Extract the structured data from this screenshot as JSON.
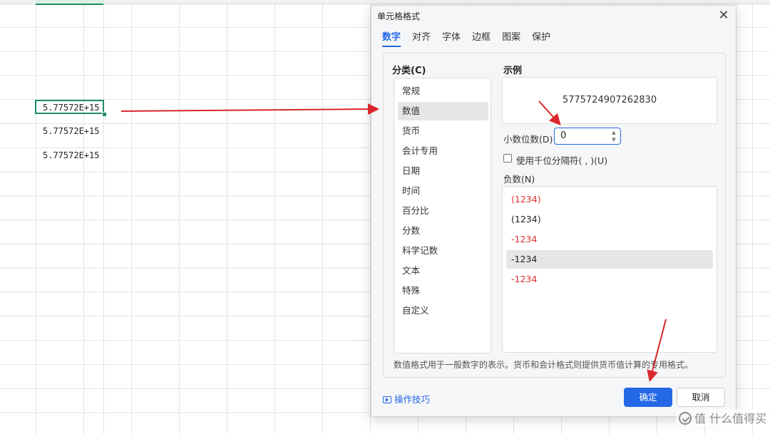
{
  "sheet": {
    "cells": [
      "5.77572E+15",
      "5.77572E+15",
      "5.77572E+15"
    ]
  },
  "dialog": {
    "title": "单元格格式",
    "close_icon": "close-icon",
    "tabs": [
      {
        "label": "数字",
        "active": true
      },
      {
        "label": "对齐"
      },
      {
        "label": "字体"
      },
      {
        "label": "边框"
      },
      {
        "label": "图案"
      },
      {
        "label": "保护"
      }
    ],
    "category_label": "分类(C)",
    "categories": [
      "常规",
      "数值",
      "货币",
      "会计专用",
      "日期",
      "时间",
      "百分比",
      "分数",
      "科学记数",
      "文本",
      "特殊",
      "自定义"
    ],
    "selected_category": "数值",
    "sample_label": "示例",
    "sample_value": "5775724907262830",
    "decimal_label": "小数位数(D)",
    "decimal_value": "0",
    "thousands_label": "使用千位分隔符( , )(U)",
    "thousands_checked": false,
    "negative_label": "负数(N)",
    "negative_options": [
      {
        "text": "(1234)",
        "color": "#e0312b"
      },
      {
        "text": "(1234)",
        "color": "#222222"
      },
      {
        "text": "-1234",
        "color": "#e0312b"
      },
      {
        "text": "-1234",
        "color": "#222222",
        "selected": true
      },
      {
        "text": "-1234",
        "color": "#e0312b"
      }
    ],
    "description": "数值格式用于一般数字的表示。货币和会计格式则提供货币值计算的专用格式。",
    "tips_label": "操作技巧",
    "ok_label": "确定",
    "cancel_label": "取消"
  },
  "watermark": "值 什么值得买",
  "colors": {
    "accent": "#2468e6",
    "cell_border": "#1e8e5e",
    "arrow": "#d9262a"
  }
}
